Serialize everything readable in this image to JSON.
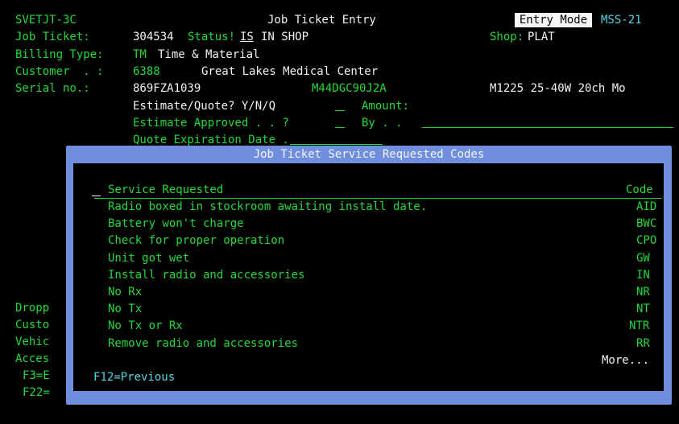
{
  "header": {
    "program": "SVETJT-3C",
    "title": "Job Ticket Entry",
    "mode": "Entry Mode",
    "system": "MSS-21"
  },
  "job": {
    "label": "Job Ticket:",
    "number": "304534",
    "status_label": "Status!",
    "status_code": "IS",
    "status_text": "IN SHOP",
    "shop_label": "Shop:",
    "shop": "PLAT"
  },
  "billing": {
    "label": "Billing Type:",
    "code": "TM",
    "text": "Time & Material"
  },
  "customer": {
    "label": "Customer  . :",
    "number": "6388",
    "name": "Great Lakes Medical Center"
  },
  "serial": {
    "label": "Serial no.:",
    "value": "869FZA1039",
    "model": "M44DGC90J2A",
    "desc": "M1225 25-40W 20ch Mo"
  },
  "estimate": {
    "quote_label": "Estimate/Quote? Y/N/Q",
    "amount_label": "Amount:",
    "approved_label": "Estimate Approved . . ?",
    "by_label": "By . .",
    "expiration_label": "Quote Expiration Date ."
  },
  "side_labels": [
    "Dropp",
    "Custo",
    "Vehic",
    "Acces",
    "F3=E",
    "F22="
  ],
  "popup": {
    "title": "Job Ticket Service Requested Codes",
    "col_service": "Service Requested",
    "col_code": "Code",
    "rows": [
      {
        "service": "Radio boxed in stockroom awaiting install date.",
        "code": "AID"
      },
      {
        "service": "Battery won't charge",
        "code": "BWC"
      },
      {
        "service": "Check for proper operation",
        "code": "CPO"
      },
      {
        "service": "Unit got wet",
        "code": "GW"
      },
      {
        "service": "Install radio and accessories",
        "code": "IN"
      },
      {
        "service": "No Rx",
        "code": "NR"
      },
      {
        "service": "No Tx",
        "code": "NT"
      },
      {
        "service": "No Tx or Rx",
        "code": "NTR"
      },
      {
        "service": "Remove radio and accessories",
        "code": "RR"
      }
    ],
    "more": "More...",
    "fkey": "F12=Previous"
  }
}
